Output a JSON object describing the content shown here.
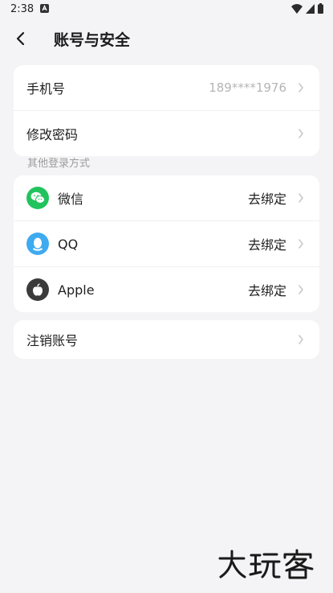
{
  "status_bar": {
    "time": "2:38"
  },
  "nav": {
    "title": "账号与安全"
  },
  "account_card": {
    "phone_label": "手机号",
    "phone_value": "189****1976",
    "password_label": "修改密码"
  },
  "other_login": {
    "section_label": "其他登录方式",
    "items": [
      {
        "label": "微信",
        "action": "去绑定",
        "icon": "wechat-icon",
        "color": "#22c35d"
      },
      {
        "label": "QQ",
        "action": "去绑定",
        "icon": "qq-icon",
        "color": "#3eaaf0"
      },
      {
        "label": "Apple",
        "action": "去绑定",
        "icon": "apple-icon",
        "color": "#3b3b3b"
      }
    ]
  },
  "cancel_card": {
    "label": "注销账号"
  },
  "watermark": {
    "text": "大玩客"
  }
}
